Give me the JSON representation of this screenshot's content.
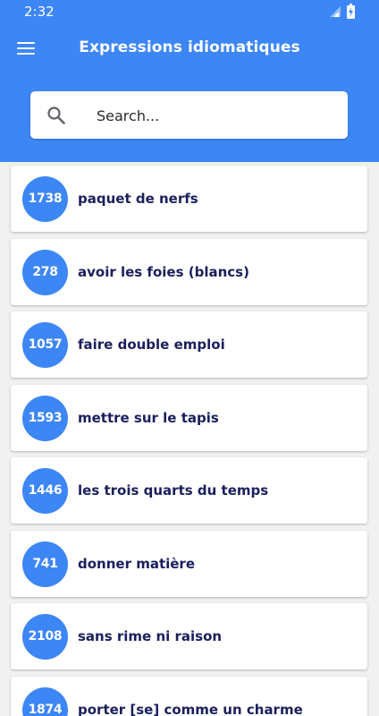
{
  "status_bar": {
    "time": "2:32"
  },
  "toolbar": {
    "title": "Expressions idiomatiques",
    "menu_icon": "hamburger-menu-icon"
  },
  "search": {
    "placeholder": "Search...",
    "value": "",
    "icon": "search-icon"
  },
  "colors": {
    "primary": "#3d86f5",
    "background": "#f1f1f1",
    "card": "#ffffff",
    "text_dark_blue": "#1a1f5c"
  },
  "expressions": [
    {
      "number": "1738",
      "text": "paquet de nerfs"
    },
    {
      "number": "278",
      "text": "avoir les foies (blancs)"
    },
    {
      "number": "1057",
      "text": "faire double emploi"
    },
    {
      "number": "1593",
      "text": "mettre sur le tapis"
    },
    {
      "number": "1446",
      "text": "les trois quarts du temps"
    },
    {
      "number": "741",
      "text": "donner matière"
    },
    {
      "number": "2108",
      "text": "sans rime ni raison"
    },
    {
      "number": "1874",
      "text": "porter [se] comme un charme"
    }
  ]
}
